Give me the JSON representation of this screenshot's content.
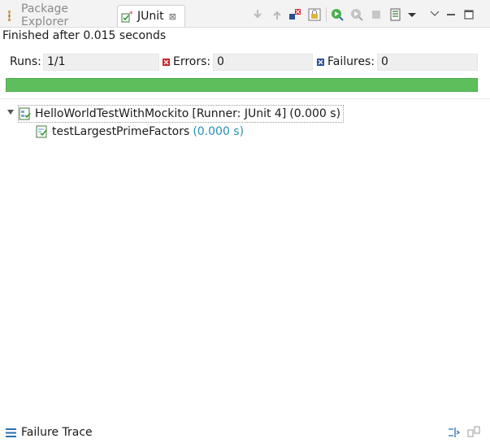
{
  "tabs": {
    "package_explorer": "Package Explorer",
    "junit": "JUnit",
    "close_glyph": "⊠"
  },
  "status": "Finished after 0.015 seconds",
  "counters": {
    "runs_label": "Runs:",
    "runs_value": "1/1",
    "errors_label": "Errors:",
    "errors_value": "0",
    "failures_label": "Failures:",
    "failures_value": "0"
  },
  "progress": {
    "fraction": 1.0,
    "color": "#5cbf5c"
  },
  "tree": {
    "root_name": "HelloWorldTestWithMockito",
    "root_runner": "[Runner: JUnit 4]",
    "root_time": "(0.000 s)",
    "child_name": "testLargestPrimeFactors",
    "child_time": "(0.000 s)"
  },
  "footer": {
    "title": "Failure Trace"
  },
  "colors": {
    "accent_green": "#5cbf5c",
    "time_blue": "#2a8fb8",
    "error_red": "#c8232c",
    "failure_blue": "#2b4f9a"
  }
}
